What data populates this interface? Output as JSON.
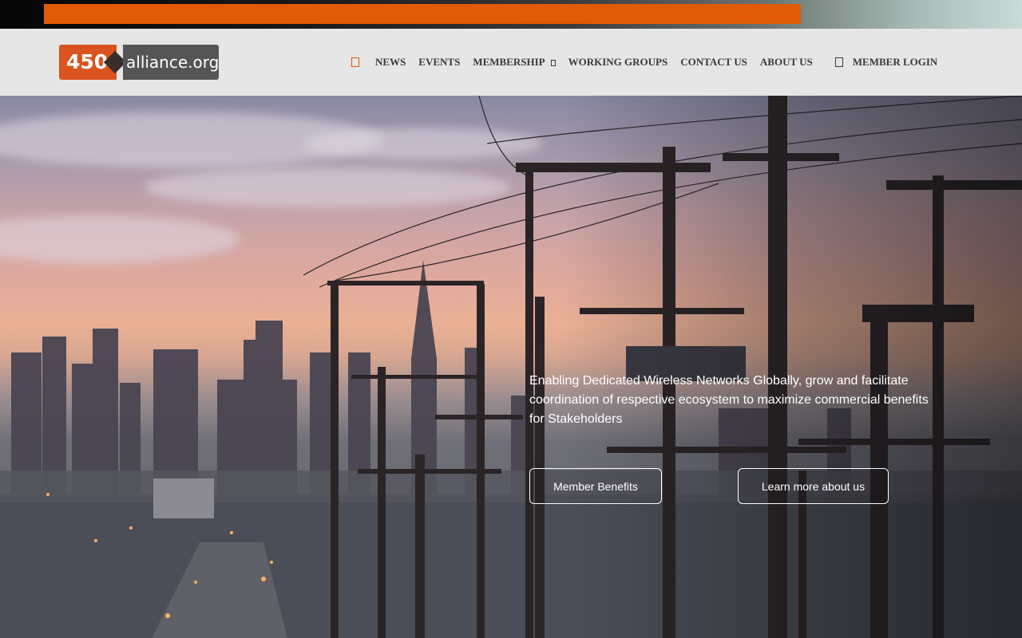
{
  "logo": {
    "number": "450",
    "domain": "alliance.org"
  },
  "nav": {
    "home_icon": "home-icon",
    "items": [
      "NEWS",
      "EVENTS",
      "MEMBERSHIP",
      "WORKING GROUPS",
      "CONTACT US",
      "ABOUT US"
    ],
    "login_icon": "user-icon",
    "login_label": "MEMBER LOGIN"
  },
  "hero": {
    "tagline": "Enabling Dedicated Wireless Networks Globally, grow and facilitate coordination of respective ecosystem to maximize commercial benefits for Stakeholders",
    "buttons": {
      "benefits": "Member Benefits",
      "about": "Learn more about us"
    }
  },
  "colors": {
    "accent": "#e05a08",
    "logo_orange": "#d9541e",
    "logo_gray": "#555555",
    "header_bg": "#e6e6e6",
    "nav_text": "#3a3a3a"
  }
}
